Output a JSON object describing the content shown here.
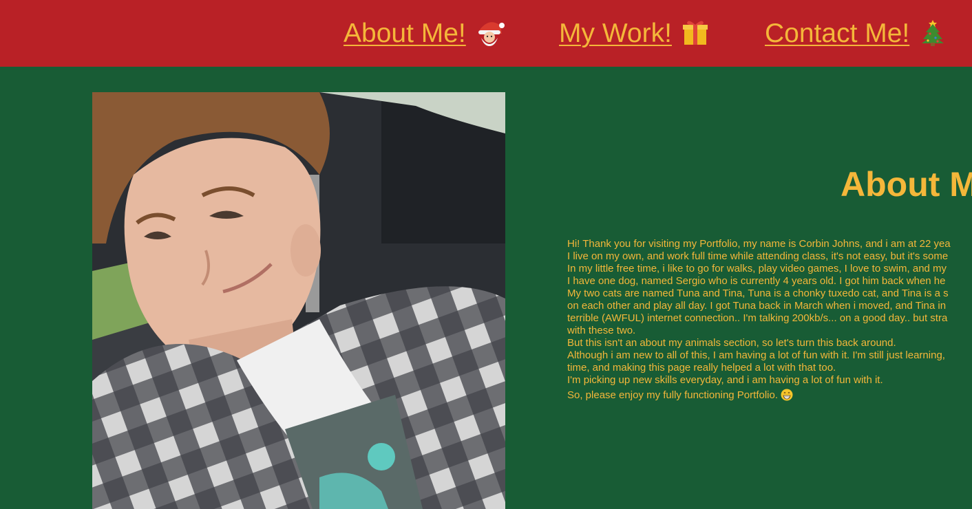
{
  "nav": {
    "about_label": "About Me!",
    "about_icon": "santa-icon",
    "work_label": "My Work!",
    "work_icon": "gift-icon",
    "contact_label": "Contact Me!",
    "contact_icon": "christmas-tree-icon"
  },
  "colors": {
    "header_bg": "#b92126",
    "page_bg": "#185c35",
    "accent_text": "#f4b73a"
  },
  "main": {
    "title": "About M",
    "lines": [
      "Hi! Thank you for visiting my Portfolio, my name is Corbin Johns, and i am at 22 yea",
      "I live on my own, and work full time while attending class, it's not easy, but it's some",
      "In my little free time, i like to go for walks, play video games, I love to swim, and my",
      "I have one dog, named Sergio who is currently 4 years old. I got him back when he",
      "My two cats are named Tuna and Tina, Tuna is a chonky tuxedo cat, and Tina is a s",
      "on each other and play all day. I got Tuna back in March when i moved, and Tina in",
      "terrible (AWFUL) internet connection.. I'm talking 200kb/s... on a good day.. but stra",
      "with these two.",
      "But this isn't an about my animals section, so let's turn this back around.",
      "Although i am new to all of this, I am having a lot of fun with it. I'm still just learning,",
      "time, and making this page really helped a lot with that too.",
      "I'm picking up new skills everyday, and i am having a lot of fun with it.",
      "So, please enjoy my fully functioning Portfolio."
    ],
    "closing_icon": "grinning-face-icon",
    "photo_icon": "profile-photo"
  }
}
